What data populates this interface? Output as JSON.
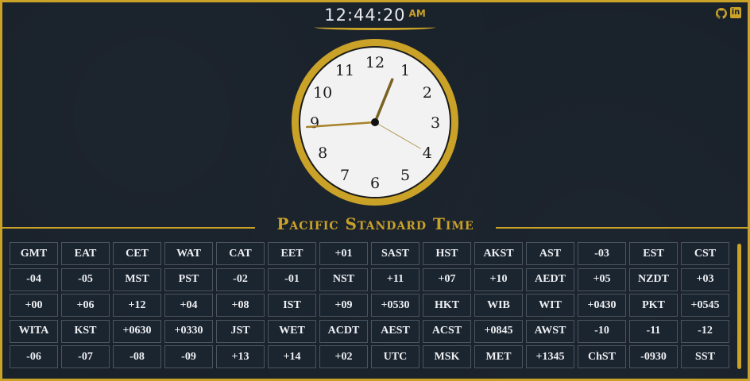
{
  "digital_clock": {
    "time": "12:44:20",
    "ampm": "AM"
  },
  "analog_clock": {
    "numerals": [
      "12",
      "1",
      "2",
      "3",
      "4",
      "5",
      "6",
      "7",
      "8",
      "9",
      "10",
      "11"
    ],
    "hours": 12,
    "minutes": 44,
    "seconds": 20
  },
  "header": {
    "github_icon": "github-icon",
    "linkedin_icon": "linkedin-icon"
  },
  "timezone": {
    "name": "Pacific Standard Time"
  },
  "colors": {
    "accent": "#c9a227",
    "background": "#18202a",
    "cell_border": "#4a5560"
  },
  "timezone_buttons": [
    "GMT",
    "EAT",
    "CET",
    "WAT",
    "CAT",
    "EET",
    "+01",
    "SAST",
    "HST",
    "AKST",
    "AST",
    "-03",
    "EST",
    "CST",
    "-04",
    "-05",
    "MST",
    "PST",
    "-02",
    "-01",
    "NST",
    "+11",
    "+07",
    "+10",
    "AEDT",
    "+05",
    "NZDT",
    "+03",
    "+00",
    "+06",
    "+12",
    "+04",
    "+08",
    "IST",
    "+09",
    "+0530",
    "HKT",
    "WIB",
    "WIT",
    "+0430",
    "PKT",
    "+0545",
    "WITA",
    "KST",
    "+0630",
    "+0330",
    "JST",
    "WET",
    "ACDT",
    "AEST",
    "ACST",
    "+0845",
    "AWST",
    "-10",
    "-11",
    "-12",
    "-06",
    "-07",
    "-08",
    "-09",
    "+13",
    "+14",
    "+02",
    "UTC",
    "MSK",
    "MET",
    "+1345",
    "ChST",
    "-0930",
    "SST"
  ]
}
